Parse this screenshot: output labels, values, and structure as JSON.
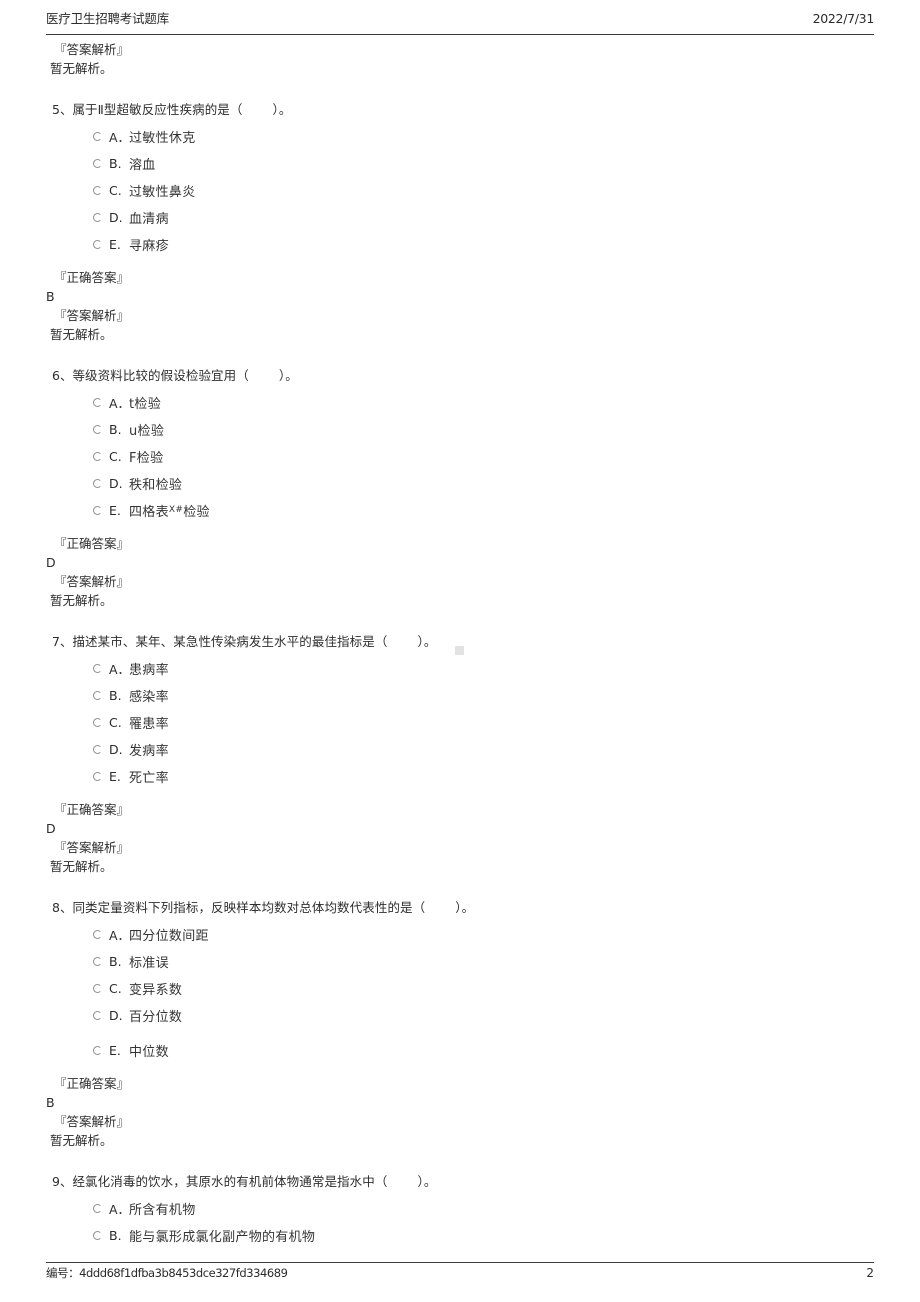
{
  "header": {
    "title": "医疗卫生招聘考试题库",
    "date": "2022/7/31"
  },
  "footer": {
    "code_label": "编号：",
    "code": "4ddd68f1dfba3b8453dce327fd334689",
    "code_full": "编号：4ddd68f1dfba3b8453dce327fd334689",
    "page_number": "2"
  },
  "labels": {
    "correct_answer": "『正确答案』",
    "answer_explanation": "『答案解析』",
    "no_explanation": "暂无解析。"
  },
  "top_partial": {
    "explanation_label": "『答案解析』",
    "explanation_text": "暂无解析。"
  },
  "questions": [
    {
      "number": "5、",
      "stem_before": "属于Ⅱ型超敏反应性疾病的是（",
      "stem_after": "）。",
      "options": [
        {
          "letter": "A．",
          "text": "过敏性休克"
        },
        {
          "letter": "B.",
          "text": "溶血"
        },
        {
          "letter": "C.",
          "text": "过敏性鼻炎"
        },
        {
          "letter": "D.",
          "text": "血清病"
        },
        {
          "letter": "E.",
          "text": "寻麻疹"
        }
      ],
      "answer": "B",
      "explanation": "暂无解析。"
    },
    {
      "number": "6、",
      "stem_before": "等级资料比较的假设检验宜用（",
      "stem_after": "）。",
      "options": [
        {
          "letter": "A．",
          "text": "t检验"
        },
        {
          "letter": "B.",
          "text": "u检验"
        },
        {
          "letter": "C.",
          "text": "F检验"
        },
        {
          "letter": "D.",
          "text": "秩和检验"
        },
        {
          "letter": "E.",
          "text": "四格表",
          "sup": "X#",
          "text_after": "检验"
        }
      ],
      "answer": "D",
      "explanation": "暂无解析。"
    },
    {
      "number": "7、",
      "stem_before": "描述某市、某年、某急性传染病发生水平的最佳指标是（",
      "stem_after": "）。",
      "options": [
        {
          "letter": "A．",
          "text": "患病率"
        },
        {
          "letter": "B.",
          "text": "感染率"
        },
        {
          "letter": "C.",
          "text": "罹患率"
        },
        {
          "letter": "D.",
          "text": "发病率"
        },
        {
          "letter": "E.",
          "text": "死亡率"
        }
      ],
      "answer": "D",
      "explanation": "暂无解析。"
    },
    {
      "number": "8、",
      "stem_before": "同类定量资料下列指标，反映样本均数对总体均数代表性的是（",
      "stem_after": "）。",
      "options": [
        {
          "letter": "A．",
          "text": "四分位数间距"
        },
        {
          "letter": "B.",
          "text": "标准误"
        },
        {
          "letter": "C.",
          "text": "变异系数"
        },
        {
          "letter": "D.",
          "text": "百分位数"
        },
        {
          "letter": "E.",
          "text": "中位数"
        }
      ],
      "answer": "B",
      "explanation": "暂无解析。"
    },
    {
      "number": "9、",
      "stem_before": "经氯化消毒的饮水，其原水的有机前体物通常是指水中（",
      "stem_after": "）。",
      "options": [
        {
          "letter": "A．",
          "text": "所含有机物"
        },
        {
          "letter": "B.",
          "text": "能与氯形成氯化副产物的有机物"
        }
      ]
    }
  ]
}
